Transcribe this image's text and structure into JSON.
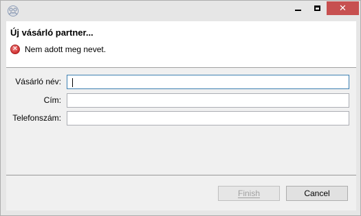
{
  "window": {
    "icon": "app-logo-icon",
    "controls": {
      "minimize": "minimize-icon",
      "maximize": "maximize-icon",
      "close": "close-icon",
      "close_glyph": "✕",
      "close_color": "#c75050"
    }
  },
  "header": {
    "title": "Új vásárló partner...",
    "message": "Nem adott meg nevet.",
    "message_icon": "error-icon",
    "message_icon_glyph": "✕"
  },
  "form": {
    "fields": [
      {
        "label": "Vásárló név:",
        "value": "",
        "focused": true
      },
      {
        "label": "Cím:",
        "value": ""
      },
      {
        "label": "Telefonszám:",
        "value": ""
      }
    ]
  },
  "buttons": {
    "finish": {
      "label": "Finish",
      "enabled": false
    },
    "cancel": {
      "label": "Cancel",
      "enabled": true
    }
  }
}
